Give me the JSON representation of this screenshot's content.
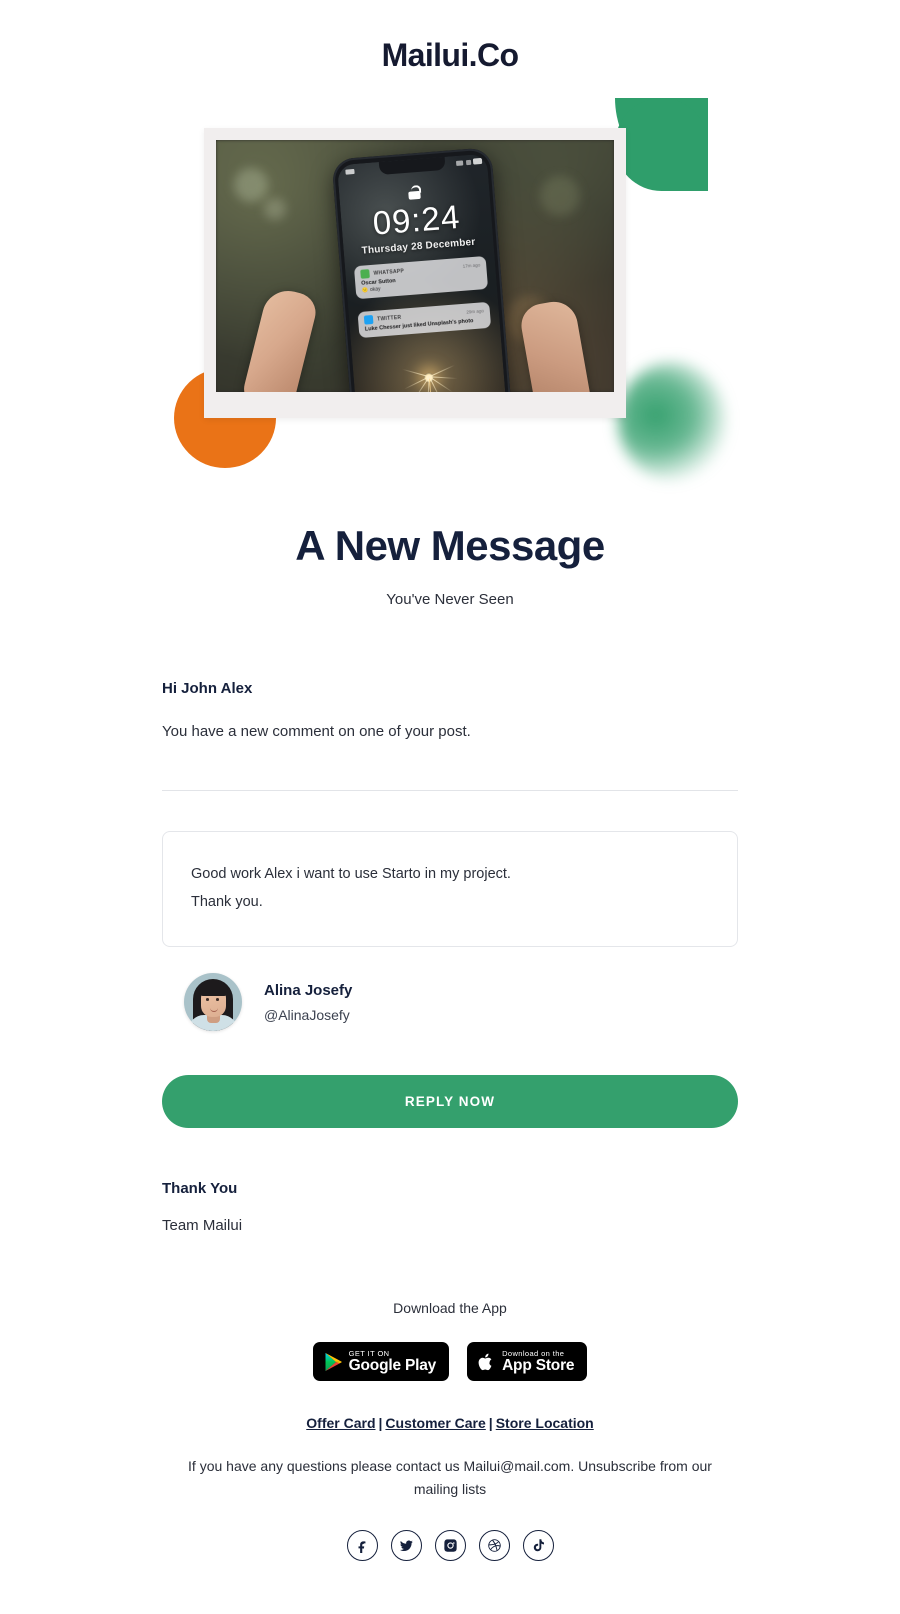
{
  "header": {
    "logo": "Mailui.Co"
  },
  "hero": {
    "alt_name": "hand-holding-phone-photo",
    "phone": {
      "time": "09:24",
      "date": "Thursday 28 December",
      "notifications": [
        {
          "app": "WHATSAPP",
          "time": "17m ago",
          "title": "Oscar Sutton",
          "body": "okay"
        },
        {
          "app": "TWITTER",
          "time": "29m ago",
          "title": "Luke Chesser just liked Unsplash's photo",
          "body": ""
        }
      ]
    },
    "decor_colors": {
      "green": "#2f9e6b",
      "orange": "#ea7317",
      "green_blur": "#35a06e"
    }
  },
  "main": {
    "title": "A New Message",
    "subtitle": "You've Never Seen",
    "greeting": "Hi John Alex",
    "lead": "You have a new comment on one of your post.",
    "comment": {
      "line1": "Good work Alex i want to use Starto in my project.",
      "line2": "Thank you."
    },
    "author": {
      "name": "Alina Josefy",
      "handle": "@AlinaJosefy"
    },
    "cta_label": "REPLY NOW",
    "signoff_title": "Thank You",
    "signoff_team": "Team Mailui",
    "accent_color": "#34a06d"
  },
  "footer": {
    "download_text": "Download the App",
    "badges": [
      {
        "small": "GET IT ON",
        "big": "Google Play",
        "icon": "google-play-icon"
      },
      {
        "small": "Download on the",
        "big": "App Store",
        "icon": "apple-icon"
      }
    ],
    "links": [
      {
        "label": "Offer Card"
      },
      {
        "label": "Customer Care"
      },
      {
        "label": "Store Location"
      }
    ],
    "link_separator": "|",
    "contact": "If you have any questions please contact us Mailui@mail.com. Unsubscribe from our mailing lists",
    "socials": [
      {
        "name": "facebook"
      },
      {
        "name": "twitter"
      },
      {
        "name": "instagram"
      },
      {
        "name": "dribbble"
      },
      {
        "name": "tiktok"
      }
    ]
  }
}
